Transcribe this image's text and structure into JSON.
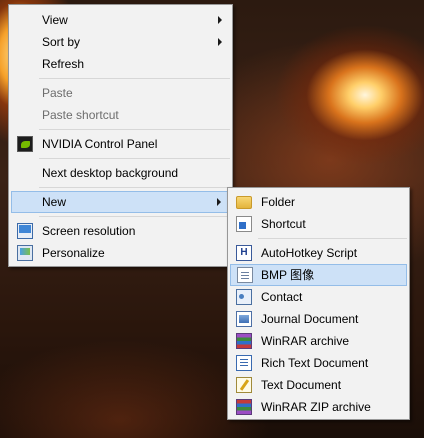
{
  "context_menu": {
    "view": "View",
    "sort_by": "Sort by",
    "refresh": "Refresh",
    "paste": "Paste",
    "paste_shortcut": "Paste shortcut",
    "nvidia_control_panel": "NVIDIA Control Panel",
    "next_desktop_background": "Next desktop background",
    "new": "New",
    "screen_resolution": "Screen resolution",
    "personalize": "Personalize"
  },
  "new_submenu": {
    "folder": "Folder",
    "shortcut": "Shortcut",
    "autohotkey_script": "AutoHotkey Script",
    "bmp_image": "BMP 图像",
    "contact": "Contact",
    "journal_document": "Journal Document",
    "winrar_archive": "WinRAR archive",
    "rich_text_document": "Rich Text Document",
    "text_document": "Text Document",
    "winrar_zip_archive": "WinRAR ZIP archive"
  },
  "icons": {
    "nvidia": "nvidia-icon",
    "screen_resolution": "screen-resolution-icon",
    "personalize": "personalize-icon",
    "folder": "folder-icon",
    "shortcut": "shortcut-icon",
    "autohotkey_glyph": "H",
    "bmp": "bmp-file-icon",
    "contact": "contact-icon",
    "journal": "journal-icon",
    "winrar": "winrar-icon",
    "rtf": "rich-text-icon",
    "text": "text-document-icon",
    "winrar_zip": "winrar-zip-icon"
  },
  "colors": {
    "menu_background": "#f2f2f2",
    "highlight_fill": "#cde1f7",
    "highlight_border": "#94bde8",
    "disabled_text": "#6d6d6d"
  }
}
